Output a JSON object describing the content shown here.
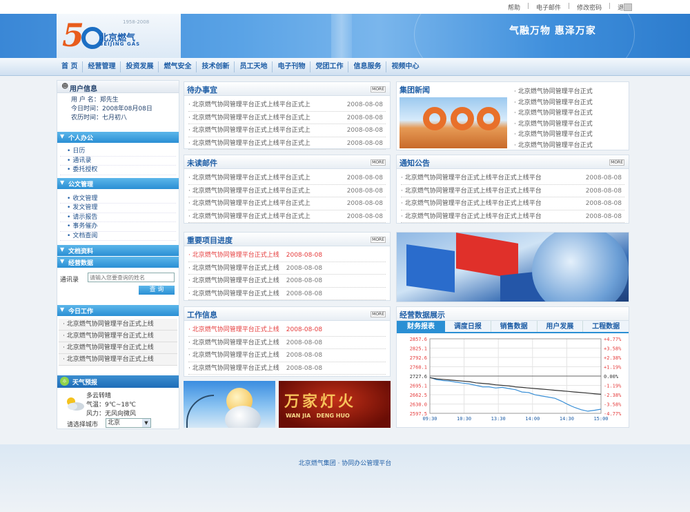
{
  "util": {
    "links": [
      "帮助",
      "电子邮件",
      "修改密码",
      "退 出"
    ]
  },
  "banner": {
    "logo_text": "5",
    "years": "1958-2008",
    "company_cn": "北京燃气",
    "company_en": "BEIJING GAS",
    "slogan": "气融万物  惠泽万家"
  },
  "nav": {
    "items": [
      "首 页",
      "经营管理",
      "投资发展",
      "燃气安全",
      "技术创新",
      "员工天地",
      "电子刊物",
      "党团工作",
      "信息服务",
      "视频中心"
    ]
  },
  "user": {
    "title": "用户信息",
    "name_label": "用 户 名：",
    "name_value": "郑先生",
    "date_label": "今日时间：",
    "date_value": "2008年08月08日",
    "lunar_label": "农历时间：",
    "lunar_value": "七月初八"
  },
  "personal": {
    "title": "个人办公",
    "items": [
      "日历",
      "通讯录",
      "委托授权"
    ]
  },
  "official": {
    "title": "公文管理",
    "items": [
      "收文管理",
      "发文管理",
      "请示报告",
      "事务催办",
      "文档查阅"
    ]
  },
  "docs": {
    "title": "文档资料"
  },
  "biz": {
    "title": "经营数据"
  },
  "contact": {
    "label": "通讯录",
    "placeholder": "请输入您要查询的姓名",
    "button": "查 询"
  },
  "today": {
    "title": "今日工作",
    "items": [
      "北京燃气协同管理平台正式上线",
      "北京燃气协同管理平台正式上线",
      "北京燃气协同管理平台正式上线",
      "北京燃气协同管理平台正式上线"
    ]
  },
  "weather": {
    "title": "天气预报",
    "desc": "多云转晴",
    "temp": "气温：9℃~18℃",
    "wind": "风力：无风向微风",
    "city_label": "请选择城市",
    "city": "北京"
  },
  "todo": {
    "title": "待办事宜",
    "more": "MORE",
    "rows": [
      {
        "text": "北京燃气协同管理平台正式上线平台正式上",
        "date": "2008-08-08"
      },
      {
        "text": "北京燃气协同管理平台正式上线平台正式上",
        "date": "2008-08-08"
      },
      {
        "text": "北京燃气协同管理平台正式上线平台正式上",
        "date": "2008-08-08"
      },
      {
        "text": "北京燃气协同管理平台正式上线平台正式上",
        "date": "2008-08-08"
      }
    ]
  },
  "group_news": {
    "title": "集团新闻",
    "items": [
      "北京燃气协同管理平台正式",
      "北京燃气协同管理平台正式",
      "北京燃气协同管理平台正式",
      "北京燃气协同管理平台正式",
      "北京燃气协同管理平台正式",
      "北京燃气协同管理平台正式"
    ]
  },
  "unread": {
    "title": "未读邮件",
    "more": "MORE",
    "rows": [
      {
        "text": "北京燃气协同管理平台正式上线平台正式上",
        "date": "2008-08-08"
      },
      {
        "text": "北京燃气协同管理平台正式上线平台正式上",
        "date": "2008-08-08"
      },
      {
        "text": "北京燃气协同管理平台正式上线平台正式上",
        "date": "2008-08-08"
      },
      {
        "text": "北京燃气协同管理平台正式上线平台正式上",
        "date": "2008-08-08"
      }
    ]
  },
  "notice": {
    "title": "通知公告",
    "more": "MORE",
    "rows": [
      {
        "text": "北京燃气协同管理平台正式上线平台正式上线平台",
        "date": "2008-08-08"
      },
      {
        "text": "北京燃气协同管理平台正式上线平台正式上线平台",
        "date": "2008-08-08"
      },
      {
        "text": "北京燃气协同管理平台正式上线平台正式上线平台",
        "date": "2008-08-08"
      },
      {
        "text": "北京燃气协同管理平台正式上线平台正式上线平台",
        "date": "2008-08-08"
      }
    ]
  },
  "projects": {
    "title": "重要项目进度",
    "more": "MORE",
    "rows": [
      {
        "text": "北京燃气协同管理平台正式上线",
        "date": "2008-08-08",
        "highlight": true
      },
      {
        "text": "北京燃气协同管理平台正式上线",
        "date": "2008-08-08",
        "highlight": false
      },
      {
        "text": "北京燃气协同管理平台正式上线",
        "date": "2008-08-08",
        "highlight": false
      },
      {
        "text": "北京燃气协同管理平台正式上线",
        "date": "2008-08-08",
        "highlight": false
      }
    ]
  },
  "workinfo": {
    "title": "工作信息",
    "more": "MORE",
    "rows": [
      {
        "text": "北京燃气协同管理平台正式上线",
        "date": "2008-08-08",
        "highlight": true
      },
      {
        "text": "北京燃气协同管理平台正式上线",
        "date": "2008-08-08",
        "highlight": false
      },
      {
        "text": "北京燃气协同管理平台正式上线",
        "date": "2008-08-08",
        "highlight": false
      },
      {
        "text": "北京燃气协同管理平台正式上线",
        "date": "2008-08-08",
        "highlight": false
      }
    ]
  },
  "promo": {
    "lantern_text": "万家灯火",
    "lantern_pinyin": "WAN JIA   DENG HUO"
  },
  "bizdata": {
    "title": "经营数据展示",
    "tabs": [
      "财务报表",
      "调度日报",
      "销售数据",
      "用户发展",
      "工程数据"
    ]
  },
  "chart_data": {
    "type": "line",
    "x_ticks": [
      "09:30",
      "10:30",
      "13:30",
      "14:00",
      "14:30",
      "15:00"
    ],
    "y_left_ticks": [
      "2857.6",
      "2825.1",
      "2792.6",
      "2760.1",
      "2727.6",
      "2695.1",
      "2662.5",
      "2630.0",
      "2597.5"
    ],
    "y_right_ticks": [
      "+4.77%",
      "+3.58%",
      "+2.38%",
      "+1.19%",
      "0.00%",
      "-1.19%",
      "-2.38%",
      "-3.58%",
      "-4.77%"
    ],
    "ylim": [
      2597.5,
      2857.6
    ],
    "base": 2727.6,
    "series": [
      {
        "values": [
          2723,
          2715,
          2712,
          2710,
          2706,
          2703,
          2700,
          2695,
          2690,
          2690,
          2686,
          2688,
          2684,
          2680,
          2672,
          2670,
          2662,
          2658,
          2654,
          2650,
          2640,
          2628,
          2618,
          2610,
          2605,
          2608,
          2612
        ],
        "color": "#3a8fd6"
      },
      {
        "values": [
          2722,
          2718,
          2716,
          2714,
          2712,
          2710,
          2708,
          2704,
          2702,
          2700,
          2697,
          2695,
          2693,
          2690,
          2688,
          2686,
          2684,
          2682,
          2680,
          2678,
          2676,
          2674,
          2672,
          2670,
          2668,
          2666,
          2664
        ],
        "color": "#333333"
      }
    ],
    "colors": {
      "axis_left": "#e53b3b",
      "axis_right": "#e53b3b",
      "grid": "#e4e4e4"
    }
  },
  "footer": {
    "text": "北京燃气集团 · 协同办公管理平台"
  }
}
